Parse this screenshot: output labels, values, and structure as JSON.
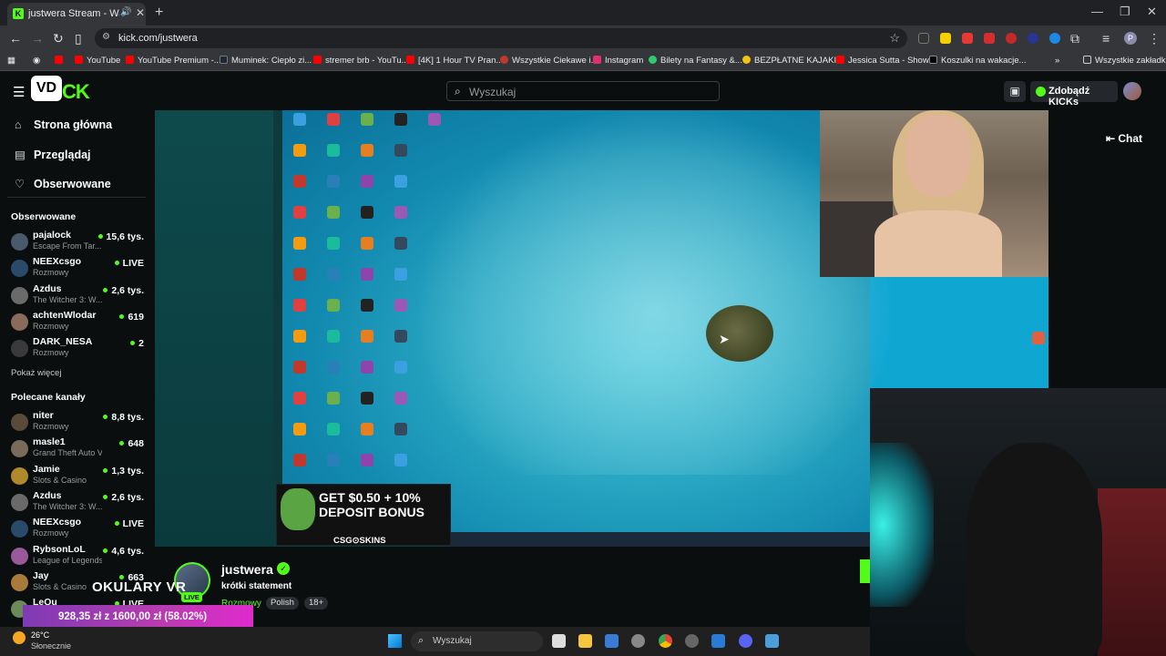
{
  "browser": {
    "tab_title": "justwera Stream - Watch Li",
    "url": "kick.com/justwera",
    "new_tab": "+",
    "bookmarks": [
      {
        "label": "YouTube",
        "color": "#ff0000"
      },
      {
        "label": "YouTube Premium -...",
        "color": "#ff0000"
      },
      {
        "label": "Muminek: Ciepło zi...",
        "color": "#1b2838"
      },
      {
        "label": "stremer brb - YouTu...",
        "color": "#ff0000"
      },
      {
        "label": "[4K] 1 Hour TV Pran...",
        "color": "#ff0000"
      },
      {
        "label": "Wszystkie Ciekawe i...",
        "color": "#c0392b"
      },
      {
        "label": "Instagram",
        "color": "#e1306c"
      },
      {
        "label": "Bilety na Fantasy &...",
        "color": "#2ecc71"
      },
      {
        "label": "BEZPŁATNE KAJAKI...",
        "color": "#f1c40f"
      },
      {
        "label": "Jessica Sutta - Show...",
        "color": "#ff0000"
      },
      {
        "label": "Koszulki na wakacje...",
        "color": "#000000"
      }
    ],
    "all_bookmarks": "Wszystkie zakładki"
  },
  "kick": {
    "search_placeholder": "Wyszukaj",
    "get_kicks": "Zdobądź KICKs",
    "logo_left": "VD",
    "logo_right": "CK",
    "nav": [
      {
        "label": "Strona główna",
        "icon": "home-icon"
      },
      {
        "label": "Przeglądaj",
        "icon": "browse-icon"
      },
      {
        "label": "Obserwowane",
        "icon": "heart-icon"
      }
    ],
    "followed_title": "Obserwowane",
    "followed": [
      {
        "name": "pajalock",
        "category": "Escape From Tar...",
        "viewers": "15,6 tys.",
        "color": "#4a5a6a"
      },
      {
        "name": "NEEXcsgo",
        "category": "Rozmowy",
        "viewers": "LIVE",
        "color": "#2a4a6a"
      },
      {
        "name": "Azdus",
        "category": "The Witcher 3: W...",
        "viewers": "2,6 tys.",
        "color": "#6a6a6a"
      },
      {
        "name": "achtenWlodar",
        "category": "Rozmowy",
        "viewers": "619",
        "color": "#8a6a5a"
      },
      {
        "name": "DARK_NESA",
        "category": "Rozmowy",
        "viewers": "2",
        "color": "#3a3a3a"
      }
    ],
    "show_more": "Pokaż więcej",
    "recommended_title": "Polecane kanały",
    "recommended": [
      {
        "name": "niter",
        "category": "Rozmowy",
        "viewers": "8,8 tys.",
        "color": "#5a4a3a"
      },
      {
        "name": "masle1",
        "category": "Grand Theft Auto V (G...",
        "viewers": "648",
        "color": "#7a6a5a"
      },
      {
        "name": "Jamie",
        "category": "Slots & Casino",
        "viewers": "1,3 tys.",
        "color": "#b08a2a"
      },
      {
        "name": "Azdus",
        "category": "The Witcher 3: W...",
        "viewers": "2,6 tys.",
        "color": "#6a6a6a"
      },
      {
        "name": "NEEXcsgo",
        "category": "Rozmowy",
        "viewers": "LIVE",
        "color": "#2a4a6a"
      },
      {
        "name": "RybsonLoL",
        "category": "League of Legends",
        "viewers": "4,6 tys.",
        "color": "#9a5a9a"
      },
      {
        "name": "Jay",
        "category": "Slots & Casino",
        "viewers": "663",
        "color": "#aa7a3a"
      },
      {
        "name": "LeQu",
        "category": "",
        "viewers": "LIVE",
        "color": "#6a8a5a"
      }
    ],
    "chat_button": "Chat",
    "streamer": {
      "name": "justwera",
      "title": "krótki statement",
      "category": "Rozmowy",
      "tags": [
        "Polish",
        "18+"
      ],
      "live": "LIVE"
    }
  },
  "overlay": {
    "ad_line1": "GET $0.50 + 10%",
    "ad_line2": "DEPOSIT BONUS",
    "ad_brand": "CSG⊙SKINS",
    "okulary": "OKULARY VR",
    "donation": "928,35 zł z 1600,00 zł (58.02%)"
  },
  "taskbar": {
    "temp": "26°C",
    "weather": "Słonecznie",
    "search_placeholder": "Wyszukaj"
  }
}
